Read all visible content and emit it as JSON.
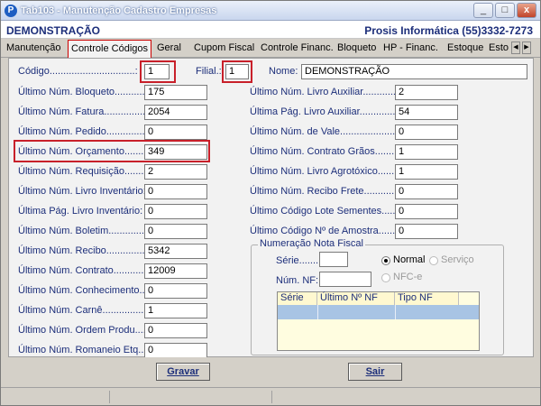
{
  "window": {
    "title": "Tab103 - Manutenção Cadastro Empresas",
    "minimize": "_",
    "maximize": "□",
    "close": "x"
  },
  "header": {
    "company": "DEMONSTRAÇÃO",
    "vendor": "Prosis Informática (55)3332-7273"
  },
  "tabs": [
    "Manutenção",
    "Controle Códigos",
    "Geral",
    "Cupom Fiscal",
    "Controle Financ.",
    "Bloqueto",
    "HP - Financ.",
    "Estoque",
    "Estoq"
  ],
  "active_tab": "Controle Códigos",
  "top_row": {
    "codigo_label": "Código...............................:",
    "codigo_value": "1",
    "filial_label": "Filial.:",
    "filial_value": "1",
    "nome_label": "Nome:",
    "nome_value": "DEMONSTRAÇÃO"
  },
  "left_fields": [
    {
      "label": "Último Núm. Bloqueto.............:",
      "value": "175"
    },
    {
      "label": "Último Núm. Fatura..................:",
      "value": "2054"
    },
    {
      "label": "Último Núm. Pedido..................:",
      "value": "0"
    },
    {
      "label": "Último Núm. Orçamento.........:",
      "value": "349"
    },
    {
      "label": "Último Núm. Requisição.......:",
      "value": "2"
    },
    {
      "label": "Último Núm. Livro Inventário:",
      "value": "0"
    },
    {
      "label": "Última  Pág. Livro  Inventário:",
      "value": "0"
    },
    {
      "label": "Último Núm. Boletim................:",
      "value": "0"
    },
    {
      "label": "Último Núm. Recibo.................:",
      "value": "5342"
    },
    {
      "label": "Último Núm. Contrato..............:",
      "value": "12009"
    },
    {
      "label": "Último Núm. Conhecimento....:",
      "value": "0"
    },
    {
      "label": "Último Núm. Carnê....................:",
      "value": "1"
    },
    {
      "label": "Último Núm. Ordem Produ......:",
      "value": "0"
    },
    {
      "label": "Último Núm. Romaneio Etq...:",
      "value": "0"
    }
  ],
  "right_fields": [
    {
      "label": "Último Núm. Livro Auxiliar................:",
      "value": "2"
    },
    {
      "label": "Última Pág. Livro Auxiliar...............:",
      "value": "54"
    },
    {
      "label": "Último Núm. de Vale.........................:",
      "value": "0"
    },
    {
      "label": "Último Núm. Contrato Grãos...........:",
      "value": "1"
    },
    {
      "label": "Último Núm. Livro Agrotóxico..........:",
      "value": "1"
    },
    {
      "label": "Último Núm. Recibo Frete................:",
      "value": "0"
    },
    {
      "label": "Último Código Lote Sementes.......:",
      "value": "0"
    },
    {
      "label": "Último Código Nº de Amostra.......:",
      "value": "0"
    }
  ],
  "nota_fiscal": {
    "title": "Numeração Nota Fiscal",
    "serie_label": "Série........:",
    "serie_value": "",
    "num_label": "Núm. NF:",
    "num_value": "",
    "radio_normal": "Normal",
    "radio_servico": "Serviço",
    "radio_nfce": "NFC-e",
    "selected": "Normal",
    "columns": [
      "Série",
      "Último Nº NF",
      "Tipo NF"
    ]
  },
  "buttons": {
    "gravar": "Gravar",
    "sair": "Sair"
  }
}
